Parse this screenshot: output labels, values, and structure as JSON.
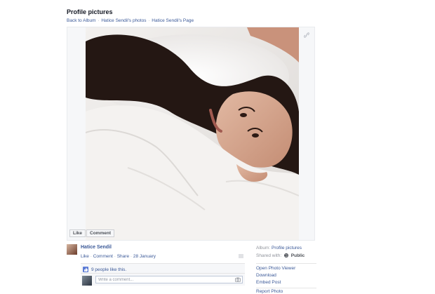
{
  "header": {
    "title": "Profile pictures",
    "breadcrumb": [
      {
        "label": "Back to Album"
      },
      {
        "label": "Hatice Sendil's photos"
      },
      {
        "label": "Hatice Sendil's Page"
      }
    ],
    "separator": "·"
  },
  "photo": {
    "like_label": "Like",
    "comment_label": "Comment",
    "icons": {
      "share": "link-icon"
    }
  },
  "story": {
    "author": "Hatice Sendil",
    "actions": {
      "like": "Like",
      "comment": "Comment",
      "share": "Share",
      "date": "28 January"
    },
    "likes_text": "9 people like this.",
    "comment_placeholder": "Write a comment..."
  },
  "sidebar": {
    "album_label": "Album:",
    "album_name": "Profile pictures",
    "shared_label": "Shared with:",
    "audience": "Public",
    "actions": [
      "Open Photo Viewer",
      "Download",
      "Embed Post",
      "Report Photo"
    ]
  },
  "colors": {
    "link": "#3b5998",
    "muted": "#90949c",
    "panel": "#f6f7f9"
  }
}
